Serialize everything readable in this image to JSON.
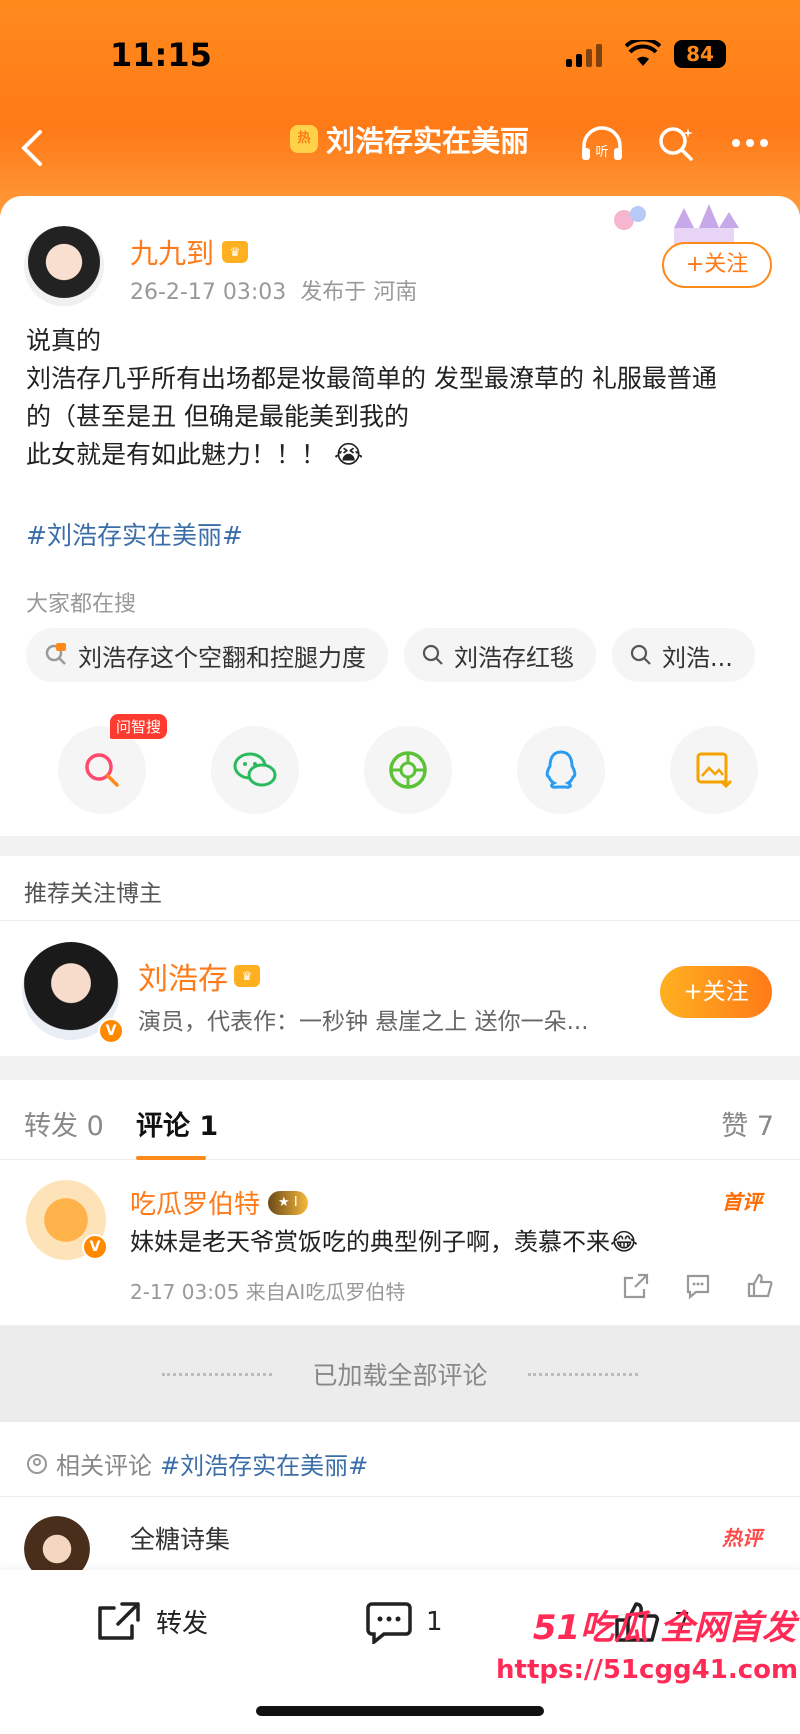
{
  "status_bar": {
    "time": "11:15",
    "battery": "84"
  },
  "nav": {
    "title": "刘浩存实在美丽",
    "hot_badge": "热"
  },
  "post": {
    "author": "九九到",
    "time": "26-2-17 03:03",
    "location": "发布于 河南",
    "follow_label": "+关注",
    "lines": [
      "说真的",
      "刘浩存几乎所有出场都是妆最简单的 发型最潦草的 礼服最普通",
      "的（甚至是丑 但确是最能美到我的",
      "此女就是有如此魅力！！！ 😭"
    ],
    "hashtag": "#刘浩存实在美丽#"
  },
  "search": {
    "label": "大家都在搜",
    "chips": [
      "刘浩存这个空翻和控腿力度",
      "刘浩存红毯",
      "刘浩..."
    ]
  },
  "share": {
    "ai_tag": "问智搜"
  },
  "recommend": {
    "title": "推荐关注博主",
    "name": "刘浩存",
    "desc": "演员，代表作：一秒钟 悬崖之上 送你一朵...",
    "follow_label": "+关注"
  },
  "tabs": {
    "repost": "转发 0",
    "comment": "评论 1",
    "like": "赞 7"
  },
  "comment": {
    "author": "吃瓜罗伯特",
    "level": "I",
    "first_tag": "首评",
    "text": "妹妹是老天爷赏饭吃的典型例子啊，羡慕不来😂",
    "meta": "2-17 03:05  来自AI吃瓜罗伯特"
  },
  "loaded_text": "已加载全部评论",
  "related": {
    "label": "相关评论",
    "tag": "#刘浩存实在美丽#",
    "name": "全糖诗集",
    "hot_tag": "热评"
  },
  "bottom": {
    "repost": "转发",
    "comment_count": "1",
    "like_count": "7"
  },
  "watermark": {
    "line1": "51吃瓜 全网首发",
    "line2": "https://51cgg41.com"
  },
  "colors": {
    "accent": "#ff7a18",
    "link": "#3b6ea8"
  }
}
